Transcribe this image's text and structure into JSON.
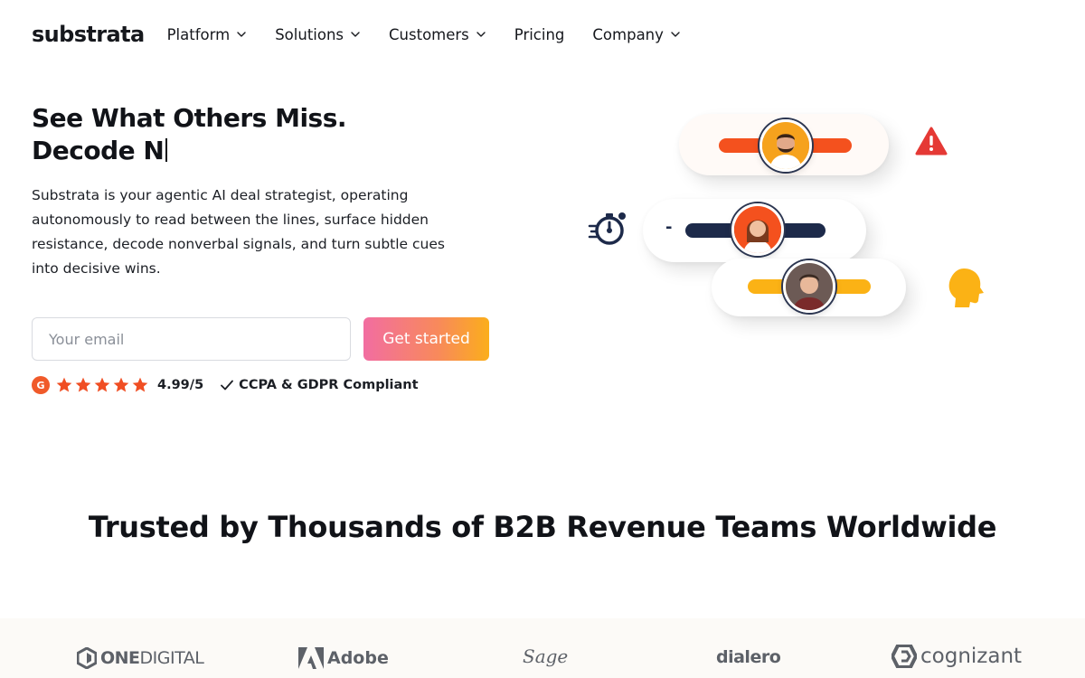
{
  "brand": {
    "logo_text": "substrata"
  },
  "nav": {
    "items": [
      {
        "label": "Platform",
        "has_dropdown": true
      },
      {
        "label": "Solutions",
        "has_dropdown": true
      },
      {
        "label": "Customers",
        "has_dropdown": true
      },
      {
        "label": "Pricing",
        "has_dropdown": false
      },
      {
        "label": "Company",
        "has_dropdown": true
      }
    ]
  },
  "hero": {
    "title_line1": "See What Others Miss.",
    "title_line2": "Decode N",
    "description": "Substrata is your agentic AI deal strategist, operating autonomously to read between the lines, surface hidden resistance, decode nonverbal signals, and turn subtle cues into decisive wins.",
    "email_placeholder": "Your email",
    "email_value": "",
    "cta_label": "Get started"
  },
  "rating": {
    "badge_letter": "G",
    "stars": 5,
    "score_text": "4.99/5",
    "compliance_text": "CCPA & GDPR Compliant"
  },
  "illustration": {
    "icons": [
      "warning-icon",
      "stopwatch-icon",
      "head-profile-icon"
    ],
    "colors": {
      "orange": "#f4511e",
      "navy": "#1d2a4a",
      "amber": "#fbb215",
      "warning": "#e53935"
    }
  },
  "trusted": {
    "heading": "Trusted by Thousands of B2B Revenue Teams Worldwide",
    "logos": [
      {
        "name": "onedigital",
        "text_bold": "ONE",
        "text_thin": "DIGITAL"
      },
      {
        "name": "adobe",
        "text": "Adobe"
      },
      {
        "name": "sage",
        "text": "Sage"
      },
      {
        "name": "dialero",
        "text": "dialero"
      },
      {
        "name": "cognizant",
        "text": "cognizant"
      }
    ]
  },
  "colors": {
    "text": "#111318",
    "cta_gradient_start": "#f26da1",
    "cta_gradient_end": "#fbae1b",
    "star": "#f04e23",
    "logo_band": "#fcfaf7"
  }
}
